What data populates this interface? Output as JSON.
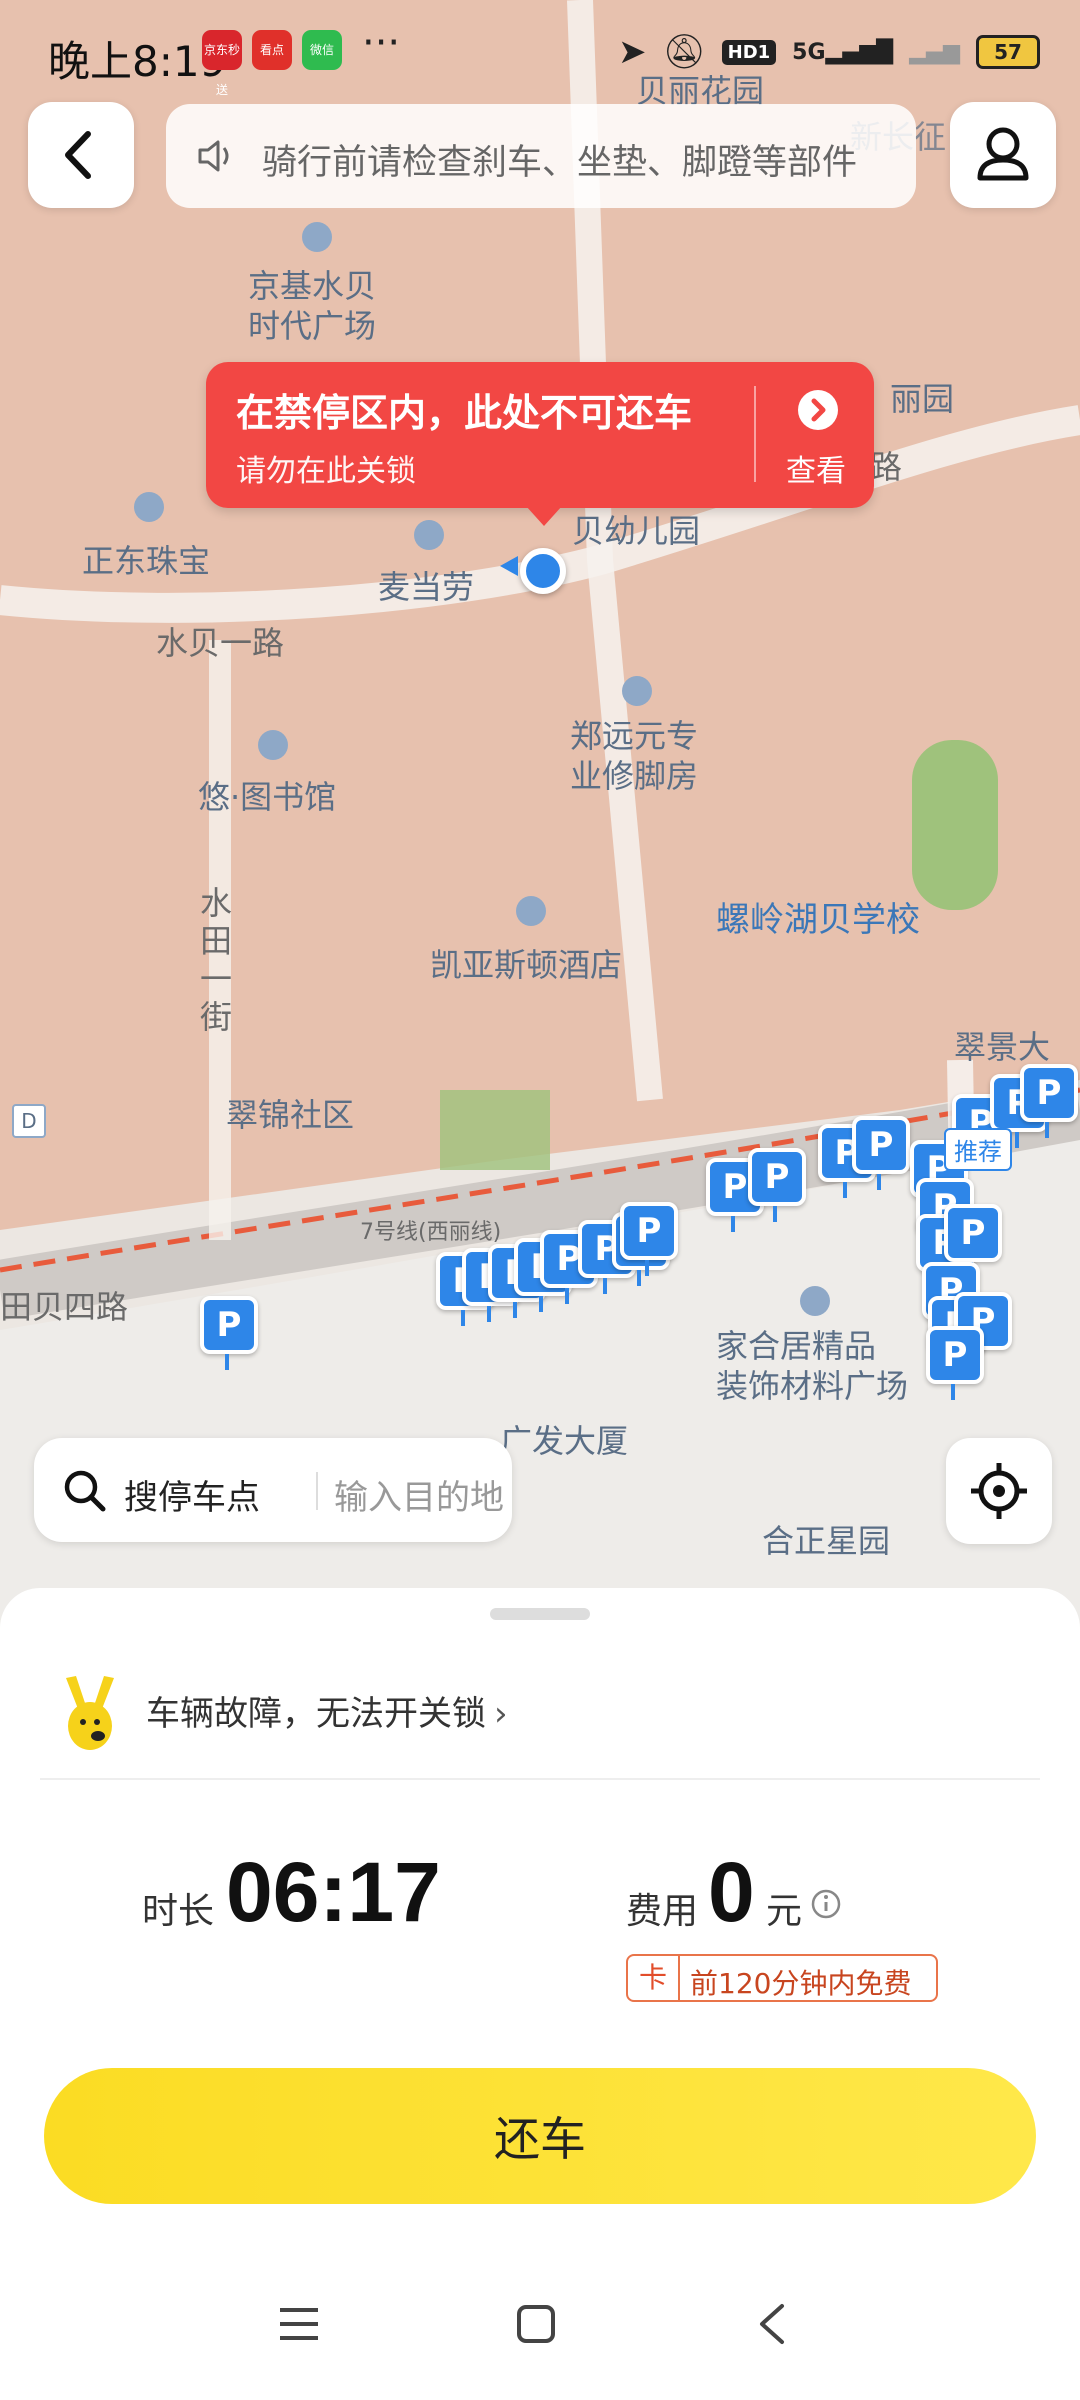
{
  "status_bar": {
    "time": "晚上8:19",
    "apps": [
      "京东秒送",
      "看点",
      "微信"
    ],
    "more": "···",
    "hd": "HD1",
    "network": "5G",
    "battery": "57"
  },
  "notice": {
    "text": "骑行前请检查刹车、坐垫、脚蹬等部件",
    "icon": "speaker-icon"
  },
  "callout": {
    "title": "在禁停区内，此处不可还车",
    "subtitle": "请勿在此关锁",
    "action": "查看"
  },
  "map": {
    "colors": {
      "forbidden_zone": "#e9b8a0",
      "parking_pin": "#2e86e8",
      "metro_line": "#e85b3c"
    },
    "labels": {
      "beili_garden": "贝丽花园",
      "jingji_mall": "京基水贝\n时代广场",
      "lili_garden": "丽园",
      "zhengdong": "正东珠宝",
      "mcd": "麦当劳",
      "kindergarten": "贝幼儿园",
      "shuibei_road": "水贝一路",
      "zhengyuan": "郑远元专\n业修脚房",
      "library": "悠·图书馆",
      "shuitian": "水\n田\n一\n街",
      "hotel": "凯亚斯顿酒店",
      "school": "螺岭湖贝学校",
      "cuijing": "翠景大",
      "cuijin": "翠锦社区",
      "metro": "7号线(西丽线)",
      "tianbei": "田贝四路",
      "jiahe": "家合居精品\n装饰材料广场",
      "guangfa": "广发大厦",
      "hezheng": "合正星园",
      "recommend": "推荐",
      "beiyi_road": "贝一路",
      "xinchang": "新长征"
    },
    "pin_letter": "P"
  },
  "search": {
    "label": "搜停车点",
    "placeholder": "输入目的地"
  },
  "sheet": {
    "fault_text": "车辆故障，无法开关锁",
    "duration_label": "时长",
    "duration_value": "06:17",
    "fee_label": "费用",
    "fee_value": "0",
    "fee_unit": "元",
    "card_tag": "卡",
    "card_text": "前120分钟内免费",
    "return_button": "还车"
  }
}
